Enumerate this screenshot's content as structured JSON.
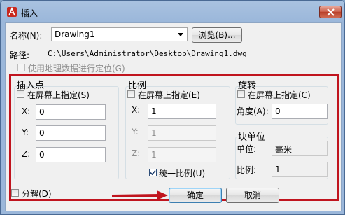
{
  "window": {
    "title": "插入"
  },
  "name_row": {
    "label": "名称(N):",
    "value": "Drawing1",
    "browse_label": "浏览(B)..."
  },
  "path_row": {
    "label": "路径:",
    "value": "C:\\Users\\Administrator\\Desktop\\Drawing1.dwg"
  },
  "geo_checkbox": {
    "label": "使用地理数据进行定位(G)"
  },
  "insertion_point": {
    "title": "插入点",
    "specify_label": "在屏幕上指定(S)",
    "x_label": "X:",
    "x_value": "0",
    "y_label": "Y:",
    "y_value": "0",
    "z_label": "Z:",
    "z_value": "0"
  },
  "scale": {
    "title": "比例",
    "specify_label": "在屏幕上指定(E)",
    "x_label": "X:",
    "x_value": "1",
    "y_label": "Y:",
    "y_value": "1",
    "z_label": "Z:",
    "z_value": "1",
    "uniform_label": "统一比例(U)"
  },
  "rotation": {
    "title": "旋转",
    "specify_label": "在屏幕上指定(C)",
    "angle_label": "角度(A):",
    "angle_value": "0"
  },
  "block_unit": {
    "title": "块单位",
    "unit_label": "单位:",
    "unit_value": "毫米",
    "factor_label": "比例:",
    "factor_value": "1"
  },
  "footer": {
    "explode_label": "分解(D)",
    "ok_label": "确定",
    "cancel_label": "取消"
  },
  "colors": {
    "annotation_red": "#c0141e"
  }
}
